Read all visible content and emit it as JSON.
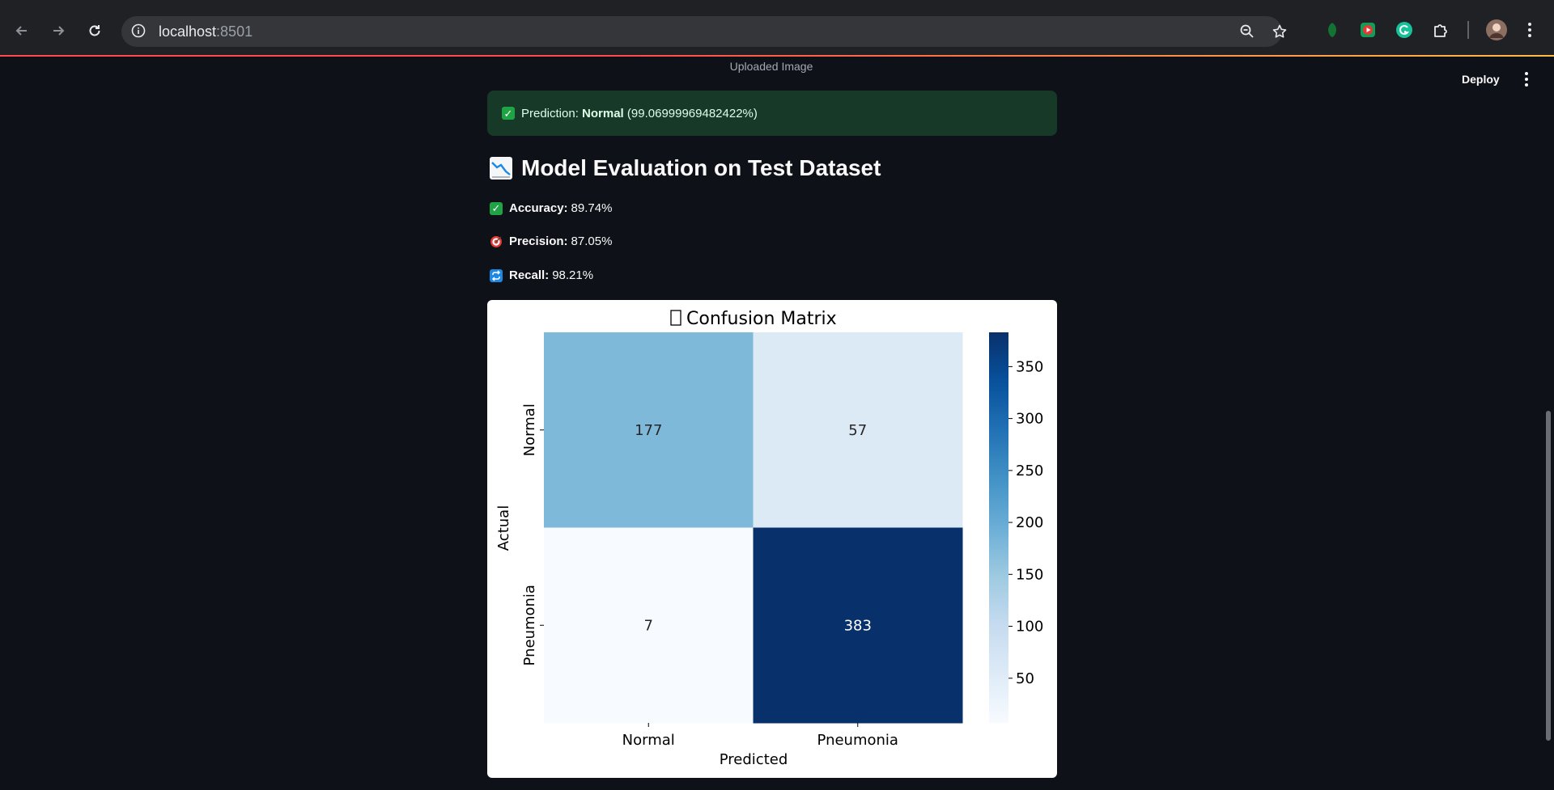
{
  "browser": {
    "url_host": "localhost",
    "url_port": ":8501"
  },
  "app": {
    "deploy_label": "Deploy",
    "uploaded_caption": "Uploaded Image",
    "prediction": {
      "prefix": "Prediction: ",
      "label": "Normal",
      "confidence": "(99.06999969482422%)"
    },
    "section_title": "Model Evaluation on Test Dataset",
    "metrics": [
      {
        "icon": "check-icon",
        "label": "Accuracy:",
        "value": "89.74%"
      },
      {
        "icon": "target-icon",
        "label": "Precision:",
        "value": "87.05%"
      },
      {
        "icon": "repeat-icon",
        "label": "Recall:",
        "value": "98.21%"
      }
    ],
    "colors": {
      "success_bg": "#173928",
      "accent": "#ff4b4b"
    }
  },
  "chart_data": {
    "type": "heatmap",
    "title": "Confusion Matrix",
    "title_icon": "missing-glyph-icon",
    "xlabel": "Predicted",
    "ylabel": "Actual",
    "x_categories": [
      "Normal",
      "Pneumonia"
    ],
    "y_categories": [
      "Normal",
      "Pneumonia"
    ],
    "values": [
      [
        177,
        57
      ],
      [
        7,
        383
      ]
    ],
    "colormap": "Blues",
    "colorbar": {
      "min": 7,
      "max": 383,
      "ticks": [
        50,
        100,
        150,
        200,
        250,
        300,
        350
      ]
    }
  }
}
